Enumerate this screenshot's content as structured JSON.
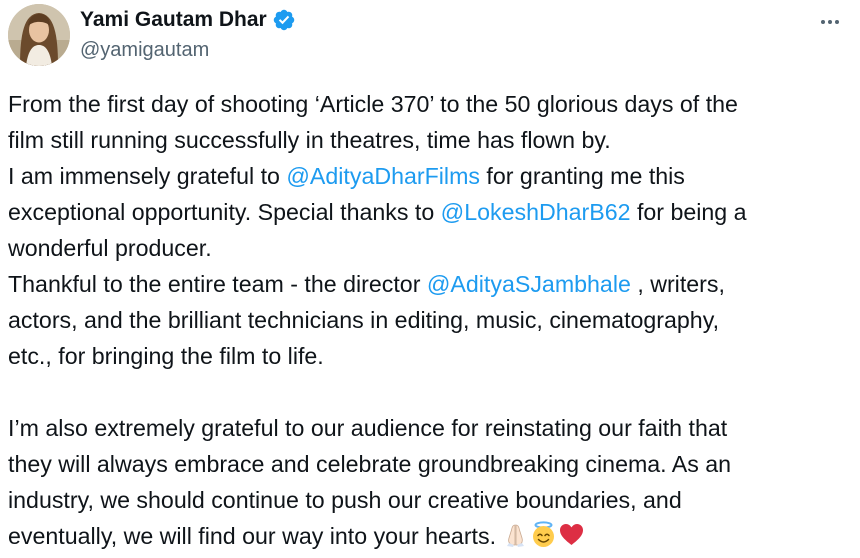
{
  "author": {
    "display_name": "Yami Gautam Dhar",
    "handle": "@yamigautam",
    "verified": true,
    "verified_color": "#1d9bf0"
  },
  "colors": {
    "text": "#0f1419",
    "secondary": "#536471",
    "link": "#1d9bf0"
  },
  "icons": {
    "more": "more-horizontal-icon",
    "verified": "verified-badge-icon",
    "emojis": [
      "folded-hands-icon",
      "smiling-face-with-halo-icon",
      "red-heart-icon"
    ]
  },
  "tweet": {
    "line1": "From the first day of shooting ‘Article 370’ to the 50 glorious days of the",
    "line2": "film still running successfully in theatres, time has flown by.",
    "line3_pre": "I am immensely grateful to ",
    "mention1": "@AdityaDharFilms",
    "line3_post": " for granting me this",
    "line4_pre": "exceptional opportunity. Special thanks to ",
    "mention2": "@LokeshDharB62",
    "line4_post": " for being a",
    "line5": "wonderful producer.",
    "line6_pre": "Thankful to the entire team - the director ",
    "mention3": "@AdityaSJambhale",
    "line6_post": " , writers,",
    "line7": "actors, and the brilliant technicians in editing, music, cinematography,",
    "line8": "etc., for bringing the film to life.",
    "line9": "I’m also extremely grateful to our audience for reinstating our faith that",
    "line10": "they will always embrace and celebrate groundbreaking cinema. As an",
    "line11": "industry, we should continue to push our creative boundaries, and",
    "line12": "eventually, we will find our way into your hearts. "
  }
}
